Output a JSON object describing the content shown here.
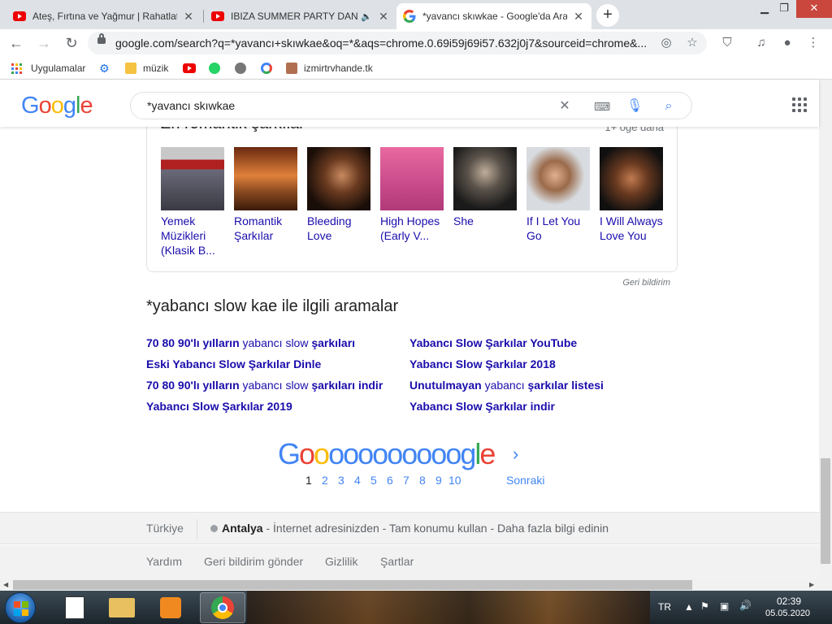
{
  "browser": {
    "tabs": [
      {
        "title": "Ateş, Fırtına ve Yağmur | Rahatlat",
        "favicon": "youtube-icon",
        "active": false
      },
      {
        "title": "IBIZA SUMMER PARTY DANC",
        "favicon": "youtube-icon",
        "active": false
      },
      {
        "title": "*yavancı skıwkae - Google'da Ara",
        "favicon": "google-icon",
        "active": true
      }
    ],
    "url": "google.com/search?q=*yavancı+skıwkae&oq=*&aqs=chrome.0.69i59j69i57.632j0j7&sourceid=chrome&..."
  },
  "bookmarks": [
    {
      "label": "Uygulamalar",
      "icon": "apps-icon"
    },
    {
      "label": "",
      "icon": "settings-icon"
    },
    {
      "label": "müzik",
      "icon": "folder-icon"
    },
    {
      "label": "",
      "icon": "youtube-icon"
    },
    {
      "label": "",
      "icon": "whatsapp-icon"
    },
    {
      "label": "",
      "icon": "globe-icon"
    },
    {
      "label": "",
      "icon": "google-icon"
    },
    {
      "label": "izmirtrvhande.tk",
      "icon": "avatar-icon"
    }
  ],
  "search": {
    "query": "*yavancı skıwkae"
  },
  "card": {
    "title": "En romantik şarkılar",
    "more": "1+ öğe daha",
    "tiles": [
      {
        "label": "Yemek Müzikleri (Klasik B..."
      },
      {
        "label": "Romantik Şarkılar"
      },
      {
        "label": "Bleeding Love"
      },
      {
        "label": "High Hopes (Early V..."
      },
      {
        "label": "She"
      },
      {
        "label": "If I Let You Go"
      },
      {
        "label": "I Will Always Love You"
      }
    ],
    "feedback": "Geri bildirim"
  },
  "related": {
    "title": "*yabancı slow kae ile ilgili aramalar",
    "left": [
      {
        "bold1": "70 80 90'lı yılların",
        "normal": " yabancı slow ",
        "bold2": "şarkıları"
      },
      {
        "bold1": "Eski Yabancı Slow Şarkılar Dinle",
        "normal": "",
        "bold2": ""
      },
      {
        "bold1": "70 80 90'lı yılların",
        "normal": " yabancı slow ",
        "bold2": "şarkıları indir"
      },
      {
        "bold1": "Yabancı Slow Şarkılar 2019",
        "normal": "",
        "bold2": ""
      }
    ],
    "right": [
      {
        "bold1": "Yabancı Slow Şarkılar YouTube",
        "normal": "",
        "bold2": ""
      },
      {
        "bold1": "Yabancı Slow Şarkılar 2018",
        "normal": "",
        "bold2": ""
      },
      {
        "bold1": "Unutulmayan",
        "normal": " yabancı ",
        "bold2": "şarkılar listesi"
      },
      {
        "bold1": "Yabancı Slow Şarkılar indir",
        "normal": "",
        "bold2": ""
      }
    ]
  },
  "pagination": {
    "pages": [
      "1",
      "2",
      "3",
      "4",
      "5",
      "6",
      "7",
      "8",
      "9",
      "10"
    ],
    "current": "1",
    "next": "Sonraki"
  },
  "footer": {
    "country": "Türkiye",
    "city": "Antalya",
    "location_text": " - İnternet adresinizden - Tam konumu kullan - Daha fazla bilgi edinin",
    "links": [
      "Yardım",
      "Geri bildirim gönder",
      "Gizlilik",
      "Şartlar"
    ]
  },
  "taskbar": {
    "language": "TR",
    "time": "02:39",
    "date": "05.05.2020"
  },
  "colors": {
    "link": "#1a0dab",
    "google_blue": "#4285f4",
    "google_red": "#ea4335",
    "google_yellow": "#fbbc05",
    "google_green": "#34a853"
  }
}
